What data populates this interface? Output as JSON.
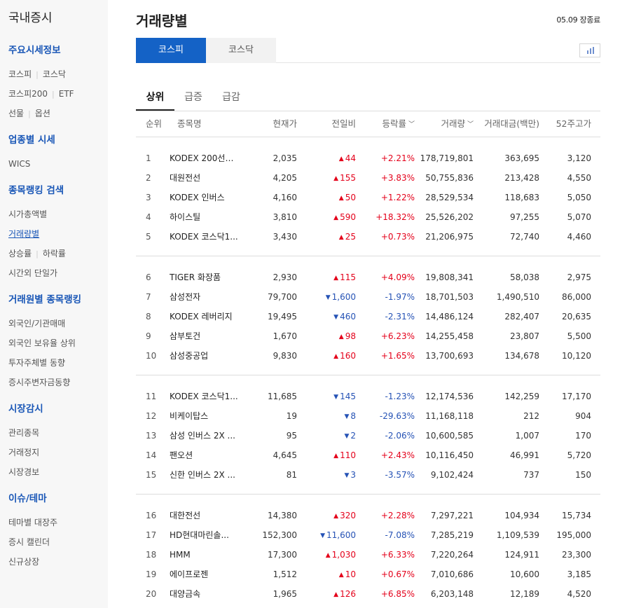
{
  "sidebar": {
    "title": "국내증시",
    "sections": [
      {
        "heading": "주요시세정보",
        "rows": [
          [
            "코스피",
            "코스닥"
          ],
          [
            "코스피200",
            "ETF"
          ],
          [
            "선물",
            "옵션"
          ]
        ]
      },
      {
        "heading": "업종별 시세",
        "rows": [
          [
            "WICS"
          ]
        ]
      },
      {
        "heading": "종목랭킹 검색",
        "rows": [
          [
            "시가총액별"
          ],
          [
            "거래량별"
          ],
          [
            "상승률",
            "하락률"
          ],
          [
            "시간외 단일가"
          ]
        ]
      },
      {
        "heading": "거래원별 종목랭킹",
        "rows": [
          [
            "외국인/기관매매"
          ],
          [
            "외국인 보유율 상위"
          ],
          [
            "투자주체별 동향"
          ],
          [
            "증시주변자금동향"
          ]
        ]
      },
      {
        "heading": "시장감시",
        "rows": [
          [
            "관리종목"
          ],
          [
            "거래정지"
          ],
          [
            "시장경보"
          ]
        ]
      },
      {
        "heading": "이슈/테마",
        "rows": [
          [
            "테마별 대장주"
          ],
          [
            "증시 캘린더"
          ],
          [
            "신규상장"
          ]
        ]
      }
    ],
    "active_link": "거래량별"
  },
  "page": {
    "title": "거래량별",
    "market_status": "05.09 장종료"
  },
  "market_tabs": {
    "kospi": "코스피",
    "kosdaq": "코스닥",
    "active": "kospi"
  },
  "sub_tabs": {
    "top": "상위",
    "surge": "급증",
    "drop": "급감",
    "active": "top"
  },
  "table": {
    "headers": {
      "rank": "순위",
      "name": "종목명",
      "price": "현재가",
      "change": "전일비",
      "rate": "등락률",
      "volume": "거래량",
      "amount": "거래대금(백만)",
      "high52": "52주고가"
    },
    "sort_arrow": "﹀",
    "rows": [
      {
        "rank": "1",
        "name": "KODEX 200선물...",
        "price": "2,035",
        "dir": "up",
        "change": "44",
        "rate": "+2.21%",
        "volume": "178,719,801",
        "amount": "363,695",
        "high52": "3,120"
      },
      {
        "rank": "2",
        "name": "대원전선",
        "price": "4,205",
        "dir": "up",
        "change": "155",
        "rate": "+3.83%",
        "volume": "50,755,836",
        "amount": "213,428",
        "high52": "4,550"
      },
      {
        "rank": "3",
        "name": "KODEX 인버스",
        "price": "4,160",
        "dir": "up",
        "change": "50",
        "rate": "+1.22%",
        "volume": "28,529,534",
        "amount": "118,683",
        "high52": "5,050"
      },
      {
        "rank": "4",
        "name": "하이스틸",
        "price": "3,810",
        "dir": "up",
        "change": "590",
        "rate": "+18.32%",
        "volume": "25,526,202",
        "amount": "97,255",
        "high52": "5,070"
      },
      {
        "rank": "5",
        "name": "KODEX 코스닥1...",
        "price": "3,430",
        "dir": "up",
        "change": "25",
        "rate": "+0.73%",
        "volume": "21,206,975",
        "amount": "72,740",
        "high52": "4,460"
      },
      {
        "rank": "6",
        "name": "TIGER 화장품",
        "price": "2,930",
        "dir": "up",
        "change": "115",
        "rate": "+4.09%",
        "volume": "19,808,341",
        "amount": "58,038",
        "high52": "2,975"
      },
      {
        "rank": "7",
        "name": "삼성전자",
        "price": "79,700",
        "dir": "down",
        "change": "1,600",
        "rate": "-1.97%",
        "volume": "18,701,503",
        "amount": "1,490,510",
        "high52": "86,000"
      },
      {
        "rank": "8",
        "name": "KODEX 레버리지",
        "price": "19,495",
        "dir": "down",
        "change": "460",
        "rate": "-2.31%",
        "volume": "14,486,124",
        "amount": "282,407",
        "high52": "20,635"
      },
      {
        "rank": "9",
        "name": "삼부토건",
        "price": "1,670",
        "dir": "up",
        "change": "98",
        "rate": "+6.23%",
        "volume": "14,255,458",
        "amount": "23,807",
        "high52": "5,500"
      },
      {
        "rank": "10",
        "name": "삼성중공업",
        "price": "9,830",
        "dir": "up",
        "change": "160",
        "rate": "+1.65%",
        "volume": "13,700,693",
        "amount": "134,678",
        "high52": "10,120"
      },
      {
        "rank": "11",
        "name": "KODEX 코스닥1...",
        "price": "11,685",
        "dir": "down",
        "change": "145",
        "rate": "-1.23%",
        "volume": "12,174,536",
        "amount": "142,259",
        "high52": "17,170"
      },
      {
        "rank": "12",
        "name": "비케이탑스",
        "price": "19",
        "dir": "down",
        "change": "8",
        "rate": "-29.63%",
        "volume": "11,168,118",
        "amount": "212",
        "high52": "904"
      },
      {
        "rank": "13",
        "name": "삼성 인버스 2X ...",
        "price": "95",
        "dir": "down",
        "change": "2",
        "rate": "-2.06%",
        "volume": "10,600,585",
        "amount": "1,007",
        "high52": "170"
      },
      {
        "rank": "14",
        "name": "팬오션",
        "price": "4,645",
        "dir": "up",
        "change": "110",
        "rate": "+2.43%",
        "volume": "10,116,450",
        "amount": "46,991",
        "high52": "5,720"
      },
      {
        "rank": "15",
        "name": "신한 인버스 2X ...",
        "price": "81",
        "dir": "down",
        "change": "3",
        "rate": "-3.57%",
        "volume": "9,102,424",
        "amount": "737",
        "high52": "150"
      },
      {
        "rank": "16",
        "name": "대한전선",
        "price": "14,380",
        "dir": "up",
        "change": "320",
        "rate": "+2.28%",
        "volume": "7,297,221",
        "amount": "104,934",
        "high52": "15,734"
      },
      {
        "rank": "17",
        "name": "HD현대마린솔...",
        "price": "152,300",
        "dir": "down",
        "change": "11,600",
        "rate": "-7.08%",
        "volume": "7,285,219",
        "amount": "1,109,539",
        "high52": "195,000"
      },
      {
        "rank": "18",
        "name": "HMM",
        "price": "17,300",
        "dir": "up",
        "change": "1,030",
        "rate": "+6.33%",
        "volume": "7,220,264",
        "amount": "124,911",
        "high52": "23,300"
      },
      {
        "rank": "19",
        "name": "에이프로젠",
        "price": "1,512",
        "dir": "up",
        "change": "10",
        "rate": "+0.67%",
        "volume": "7,010,686",
        "amount": "10,600",
        "high52": "3,185"
      },
      {
        "rank": "20",
        "name": "대양금속",
        "price": "1,965",
        "dir": "up",
        "change": "126",
        "rate": "+6.85%",
        "volume": "6,203,148",
        "amount": "12,189",
        "high52": "4,520"
      }
    ]
  },
  "colors": {
    "up": "#e4001a",
    "down": "#2552b5",
    "accent": "#1462c6",
    "section_heading": "#1a57b7"
  },
  "icons": {
    "up": "▲",
    "down": "▼",
    "chart_toggle": "bar-chart-icon"
  }
}
